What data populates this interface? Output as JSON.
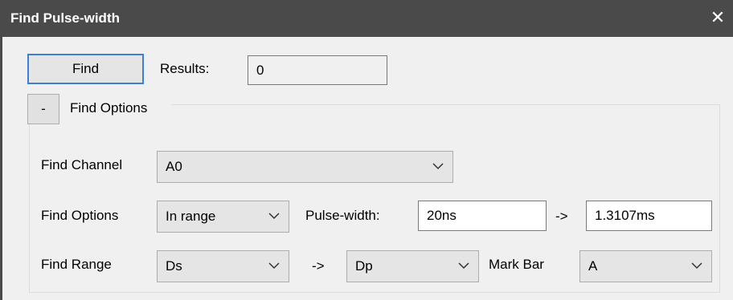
{
  "window": {
    "title": "Find Pulse-width",
    "close_icon": "close-icon"
  },
  "find_button": "Find",
  "results": {
    "label": "Results:",
    "value": "0"
  },
  "options_group": {
    "toggle_label": "-",
    "title": "Find Options"
  },
  "find_channel": {
    "label": "Find Channel",
    "value": "A0"
  },
  "find_options": {
    "label": "Find Options",
    "value": "In range"
  },
  "pulse_width": {
    "label": "Pulse-width:",
    "min": "20ns",
    "arrow": "->",
    "max": "1.3107ms"
  },
  "find_range": {
    "label": "Find Range",
    "from": "Ds",
    "arrow": "->",
    "to": "Dp"
  },
  "mark_bar": {
    "label": "Mark Bar",
    "value": "A"
  }
}
